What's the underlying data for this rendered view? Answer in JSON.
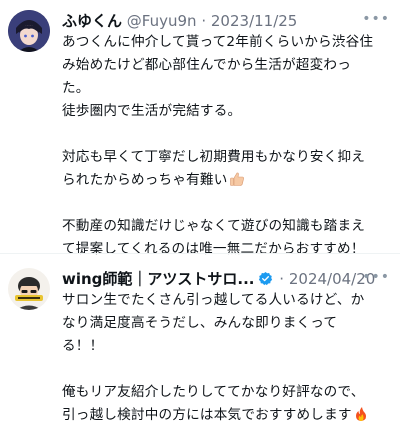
{
  "tweets": [
    {
      "avatar_icon": "anime-boy-avatar-icon",
      "name": "ふゆくん",
      "handle": "@Fuyu9n",
      "separator": "·",
      "date": "2023/11/25",
      "more": "•••",
      "lines": [
        "あつくんに仲介して貰って2年前くらいから渋谷住",
        "み始めたけど都心部住んでから生活が超変わっ",
        "た。",
        "徒歩圏内で生活が完結する。",
        "",
        "対応も早くて丁寧だし初期費用もかなり安く抑え",
        "られたからめっちゃ有難い",
        "",
        "不動産の知識だけじゃなくて遊びの知識も踏まえ",
        "て提案してくれるのは唯一無二だからおすすめ！"
      ],
      "emoji_icon": "thumbs-up-icon"
    },
    {
      "avatar_icon": "cartoon-avatar-icon",
      "name": "wing師範｜アツストサロ...",
      "verified": true,
      "separator": "·",
      "date": "2024/04/20",
      "more": "•••",
      "lines": [
        "サロン生でたくさん引っ越してる人いるけど、か",
        "なり満足度高そうだし、みんな即りまくって",
        "る！！",
        "",
        "俺もリア友紹介したりしててかなり好評なので、",
        "引っ越し検討中の方には本気でおすすめします"
      ],
      "emoji_icon": "fire-icon"
    }
  ],
  "colors": {
    "verified": "#1d9bf0",
    "meta_text": "#6b7280",
    "divider": "#eff3f4"
  }
}
